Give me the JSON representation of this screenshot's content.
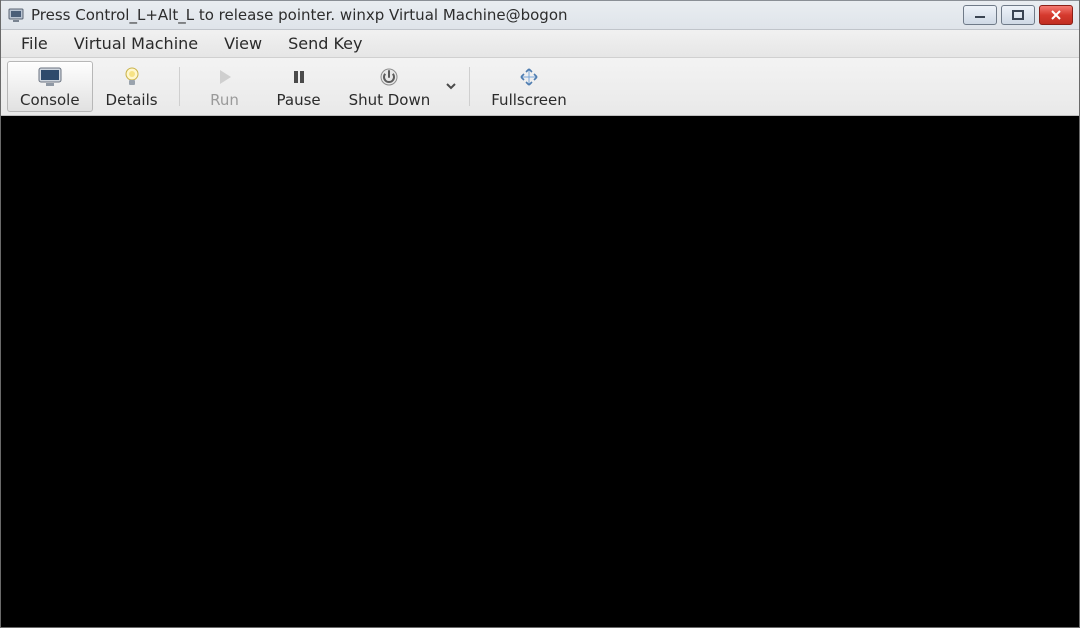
{
  "window": {
    "title": "Press Control_L+Alt_L to release pointer. winxp Virtual Machine@bogon"
  },
  "menubar": {
    "file": "File",
    "virtual_machine": "Virtual Machine",
    "view": "View",
    "send_key": "Send Key"
  },
  "toolbar": {
    "console": "Console",
    "details": "Details",
    "run": "Run",
    "pause": "Pause",
    "shutdown": "Shut Down",
    "fullscreen": "Fullscreen"
  }
}
